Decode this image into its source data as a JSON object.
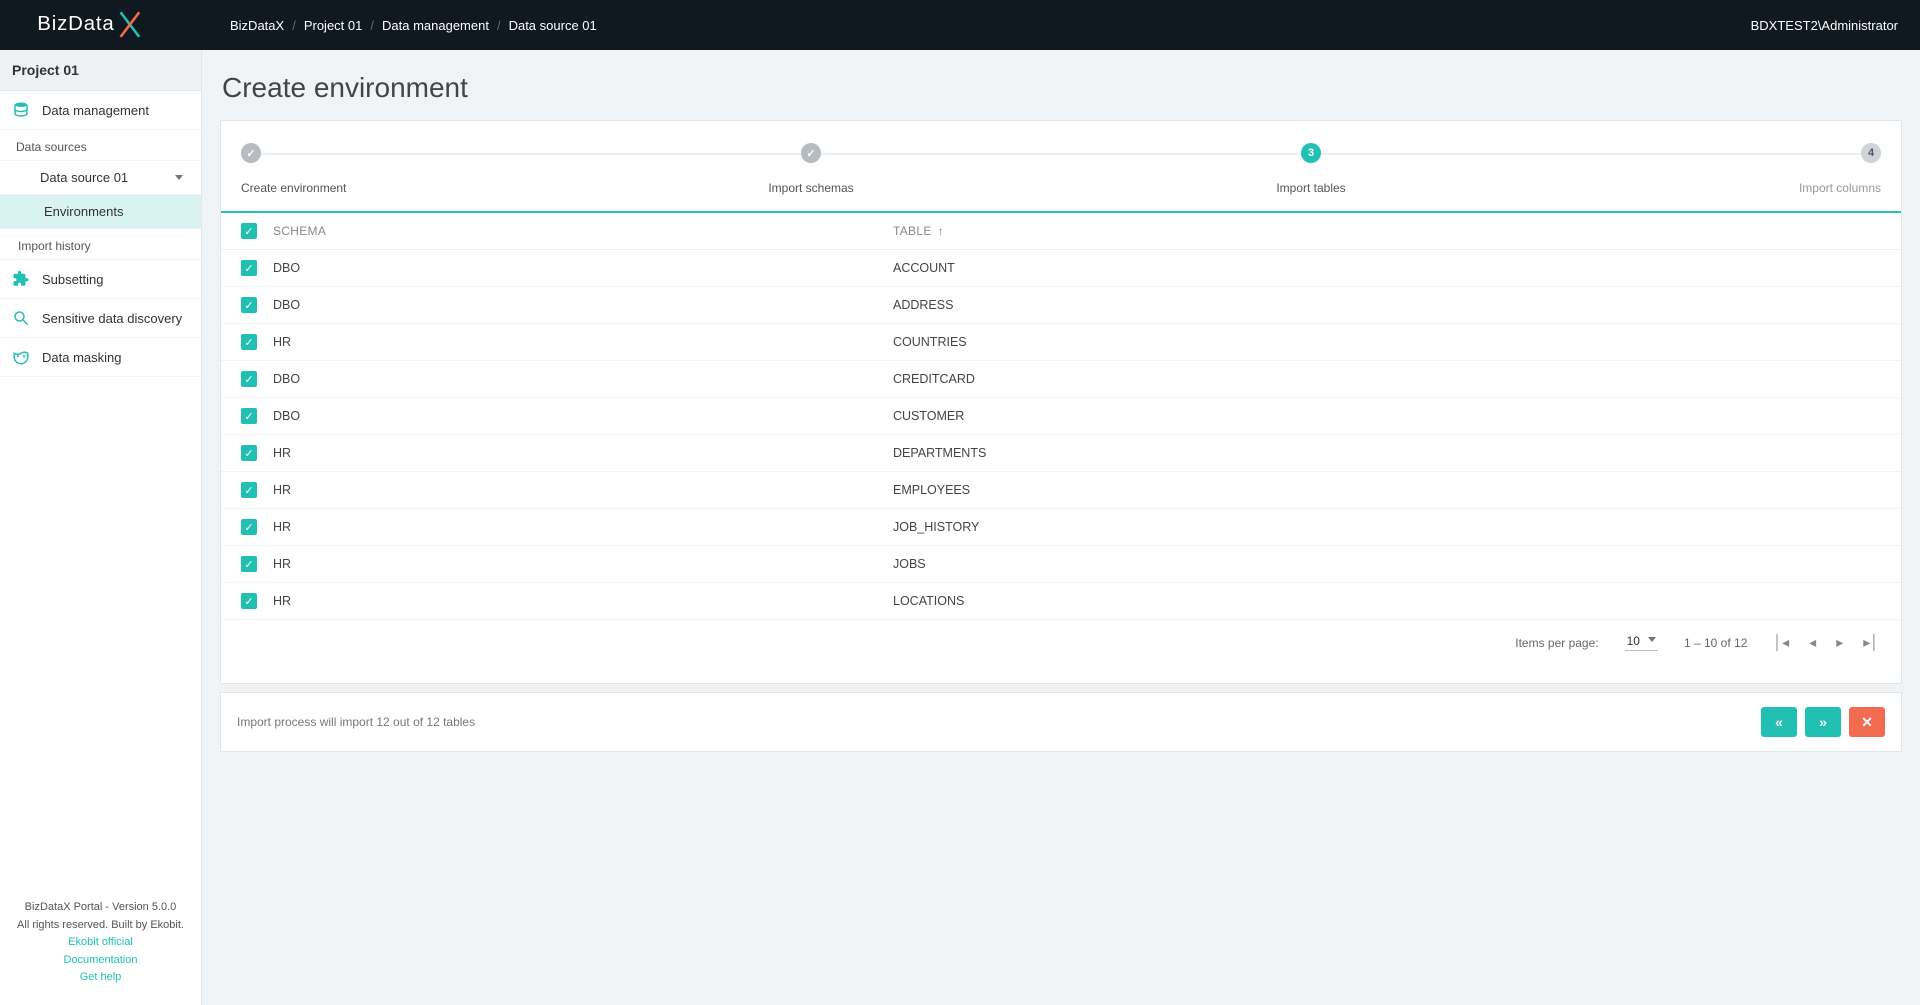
{
  "header": {
    "breadcrumbs": [
      "BizDataX",
      "Project 01",
      "Data management",
      "Data source 01"
    ],
    "user": "BDXTEST2\\Administrator"
  },
  "sidebar": {
    "project": "Project 01",
    "data_management": "Data management",
    "data_sources_label": "Data sources",
    "data_source": "Data source 01",
    "environments": "Environments",
    "import_history": "Import history",
    "subsetting": "Subsetting",
    "sensitive_discovery": "Sensitive data discovery",
    "data_masking": "Data masking",
    "footer": {
      "l1": "BizDataX Portal - Version 5.0.0",
      "l2": "All rights reserved. Built by Ekobit.",
      "link1": "Ekobit official",
      "link2": "Documentation",
      "link3": "Get help"
    }
  },
  "page": {
    "title": "Create environment"
  },
  "stepper": {
    "s1": "Create environment",
    "s2": "Import schemas",
    "s3": "Import tables",
    "s3n": "3",
    "s4": "Import columns",
    "s4n": "4"
  },
  "table": {
    "head_schema": "SCHEMA",
    "head_table": "TABLE",
    "rows": [
      {
        "schema": "DBO",
        "table": "ACCOUNT"
      },
      {
        "schema": "DBO",
        "table": "ADDRESS"
      },
      {
        "schema": "HR",
        "table": "COUNTRIES"
      },
      {
        "schema": "DBO",
        "table": "CREDITCARD"
      },
      {
        "schema": "DBO",
        "table": "CUSTOMER"
      },
      {
        "schema": "HR",
        "table": "DEPARTMENTS"
      },
      {
        "schema": "HR",
        "table": "EMPLOYEES"
      },
      {
        "schema": "HR",
        "table": "JOB_HISTORY"
      },
      {
        "schema": "HR",
        "table": "JOBS"
      },
      {
        "schema": "HR",
        "table": "LOCATIONS"
      }
    ]
  },
  "paginator": {
    "ipp_label": "Items per page:",
    "ipp_value": "10",
    "range": "1 – 10 of 12"
  },
  "footer_bar": {
    "msg": "Import process will import 12 out of 12 tables"
  }
}
